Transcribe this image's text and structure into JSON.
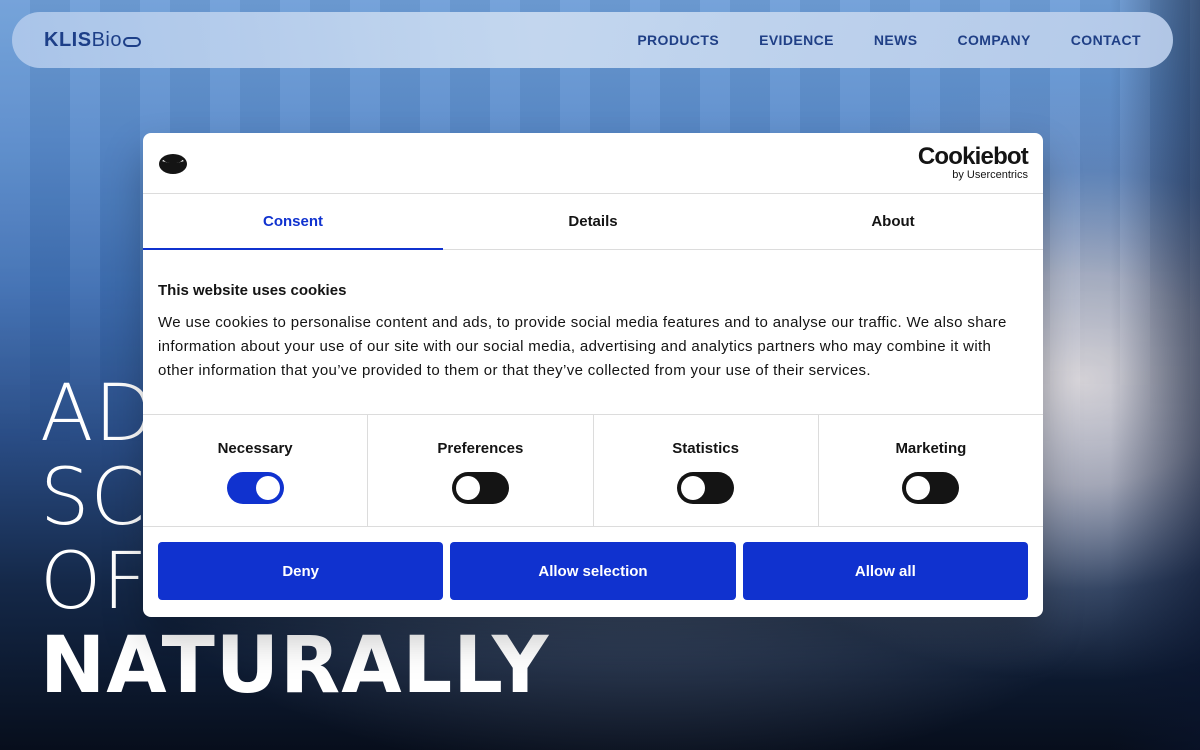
{
  "nav": {
    "logo": {
      "bold": "KLIS",
      "light": "Bio"
    },
    "links": [
      "PRODUCTS",
      "EVIDENCE",
      "NEWS",
      "COMPANY",
      "CONTACT"
    ]
  },
  "hero": {
    "lines": [
      "AD",
      "SC",
      "OF",
      "NATURALLY"
    ]
  },
  "cookie_dialog": {
    "brand": {
      "name": "Cookiebot",
      "sub": "by Usercentrics"
    },
    "tabs": [
      {
        "label": "Consent",
        "active": true
      },
      {
        "label": "Details",
        "active": false
      },
      {
        "label": "About",
        "active": false
      }
    ],
    "title": "This website uses cookies",
    "text": "We use cookies to personalise content and ads, to provide social media features and to analyse our traffic. We also share information about your use of our site with our social media, advertising and analytics partners who may combine it with other information that you’ve provided to them or that they’ve collected from your use of their services.",
    "categories": [
      {
        "label": "Necessary",
        "enabled": true
      },
      {
        "label": "Preferences",
        "enabled": false
      },
      {
        "label": "Statistics",
        "enabled": false
      },
      {
        "label": "Marketing",
        "enabled": false
      }
    ],
    "buttons": {
      "deny": "Deny",
      "allow_selection": "Allow selection",
      "allow_all": "Allow all"
    }
  },
  "colors": {
    "accent": "#1032cf",
    "nav_text": "#1f3f86"
  }
}
